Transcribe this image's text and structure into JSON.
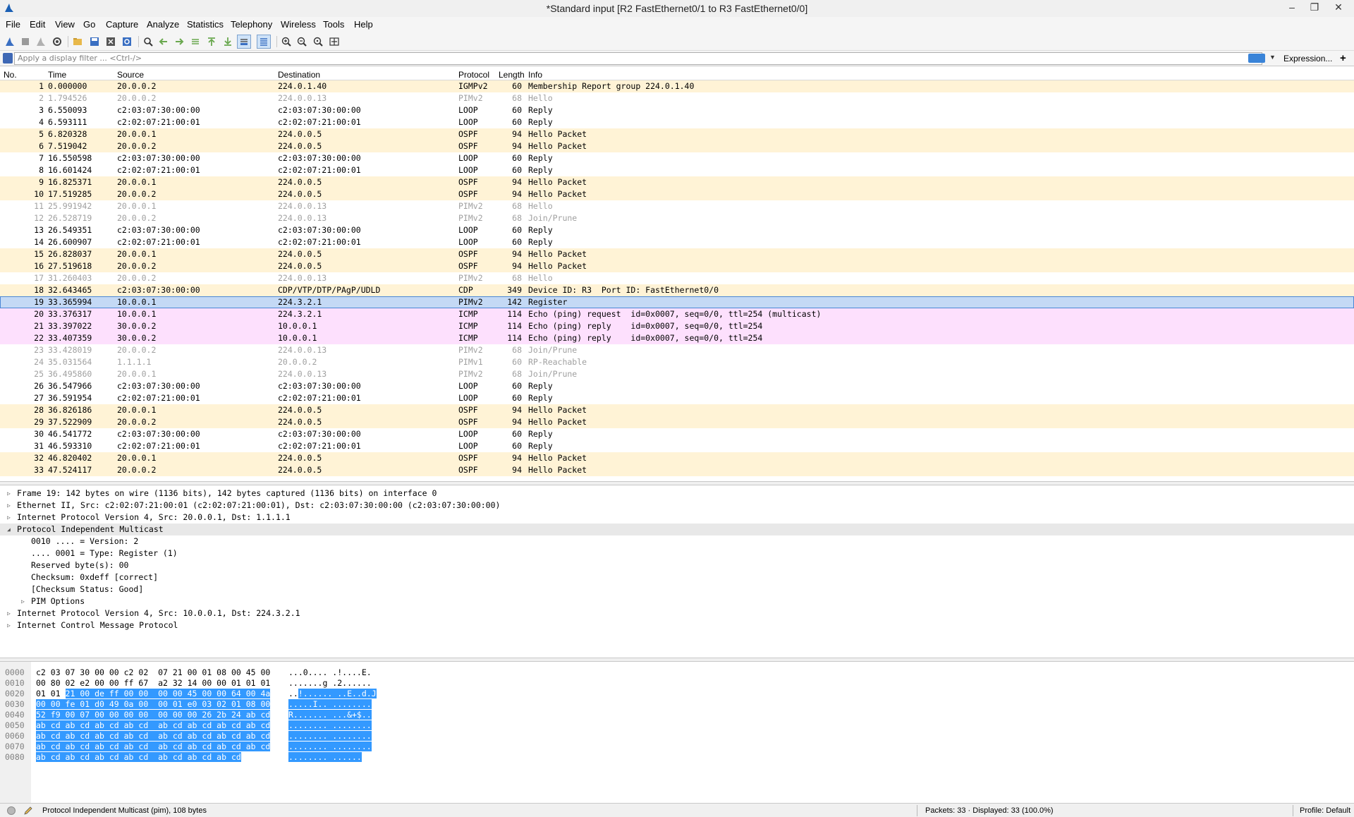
{
  "window": {
    "title": "*Standard input [R2 FastEthernet0/1 to R3 FastEthernet0/0]",
    "minimize": "–",
    "restore": "❐",
    "close": "✕"
  },
  "menu": [
    "File",
    "Edit",
    "View",
    "Go",
    "Capture",
    "Analyze",
    "Statistics",
    "Telephony",
    "Wireless",
    "Tools",
    "Help"
  ],
  "filter": {
    "placeholder": "Apply a display filter ... <Ctrl-/>",
    "expression_label": "Expression...",
    "add_label": "+",
    "dropdown_glyph": "▼"
  },
  "columns": [
    "No.",
    "Time",
    "Source",
    "Destination",
    "Protocol",
    "Length",
    "Info"
  ],
  "packets": [
    {
      "no": "1",
      "time": "0.000000",
      "src": "20.0.0.2",
      "dst": "224.0.1.40",
      "proto": "IGMPv2",
      "len": "60",
      "info": "Membership Report group 224.0.1.40",
      "cls": "igmp"
    },
    {
      "no": "2",
      "time": "1.794526",
      "src": "20.0.0.2",
      "dst": "224.0.0.13",
      "proto": "PIMv2",
      "len": "68",
      "info": "Hello",
      "cls": "pim"
    },
    {
      "no": "3",
      "time": "6.550093",
      "src": "c2:03:07:30:00:00",
      "dst": "c2:03:07:30:00:00",
      "proto": "LOOP",
      "len": "60",
      "info": "Reply",
      "cls": "loop"
    },
    {
      "no": "4",
      "time": "6.593111",
      "src": "c2:02:07:21:00:01",
      "dst": "c2:02:07:21:00:01",
      "proto": "LOOP",
      "len": "60",
      "info": "Reply",
      "cls": "loop"
    },
    {
      "no": "5",
      "time": "6.820328",
      "src": "20.0.0.1",
      "dst": "224.0.0.5",
      "proto": "OSPF",
      "len": "94",
      "info": "Hello Packet",
      "cls": "ospf"
    },
    {
      "no": "6",
      "time": "7.519042",
      "src": "20.0.0.2",
      "dst": "224.0.0.5",
      "proto": "OSPF",
      "len": "94",
      "info": "Hello Packet",
      "cls": "ospf"
    },
    {
      "no": "7",
      "time": "16.550598",
      "src": "c2:03:07:30:00:00",
      "dst": "c2:03:07:30:00:00",
      "proto": "LOOP",
      "len": "60",
      "info": "Reply",
      "cls": "loop"
    },
    {
      "no": "8",
      "time": "16.601424",
      "src": "c2:02:07:21:00:01",
      "dst": "c2:02:07:21:00:01",
      "proto": "LOOP",
      "len": "60",
      "info": "Reply",
      "cls": "loop"
    },
    {
      "no": "9",
      "time": "16.825371",
      "src": "20.0.0.1",
      "dst": "224.0.0.5",
      "proto": "OSPF",
      "len": "94",
      "info": "Hello Packet",
      "cls": "ospf"
    },
    {
      "no": "10",
      "time": "17.519285",
      "src": "20.0.0.2",
      "dst": "224.0.0.5",
      "proto": "OSPF",
      "len": "94",
      "info": "Hello Packet",
      "cls": "ospf"
    },
    {
      "no": "11",
      "time": "25.991942",
      "src": "20.0.0.1",
      "dst": "224.0.0.13",
      "proto": "PIMv2",
      "len": "68",
      "info": "Hello",
      "cls": "pim"
    },
    {
      "no": "12",
      "time": "26.528719",
      "src": "20.0.0.2",
      "dst": "224.0.0.13",
      "proto": "PIMv2",
      "len": "68",
      "info": "Join/Prune",
      "cls": "pim"
    },
    {
      "no": "13",
      "time": "26.549351",
      "src": "c2:03:07:30:00:00",
      "dst": "c2:03:07:30:00:00",
      "proto": "LOOP",
      "len": "60",
      "info": "Reply",
      "cls": "loop"
    },
    {
      "no": "14",
      "time": "26.600907",
      "src": "c2:02:07:21:00:01",
      "dst": "c2:02:07:21:00:01",
      "proto": "LOOP",
      "len": "60",
      "info": "Reply",
      "cls": "loop"
    },
    {
      "no": "15",
      "time": "26.828037",
      "src": "20.0.0.1",
      "dst": "224.0.0.5",
      "proto": "OSPF",
      "len": "94",
      "info": "Hello Packet",
      "cls": "ospf"
    },
    {
      "no": "16",
      "time": "27.519618",
      "src": "20.0.0.2",
      "dst": "224.0.0.5",
      "proto": "OSPF",
      "len": "94",
      "info": "Hello Packet",
      "cls": "ospf"
    },
    {
      "no": "17",
      "time": "31.260403",
      "src": "20.0.0.2",
      "dst": "224.0.0.13",
      "proto": "PIMv2",
      "len": "68",
      "info": "Hello",
      "cls": "pim"
    },
    {
      "no": "18",
      "time": "32.643465",
      "src": "c2:03:07:30:00:00",
      "dst": "CDP/VTP/DTP/PAgP/UDLD",
      "proto": "CDP",
      "len": "349",
      "info": "Device ID: R3  Port ID: FastEthernet0/0",
      "cls": "cdp"
    },
    {
      "no": "19",
      "time": "33.365994",
      "src": "10.0.0.1",
      "dst": "224.3.2.1",
      "proto": "PIMv2",
      "len": "142",
      "info": "Register",
      "cls": "selected"
    },
    {
      "no": "20",
      "time": "33.376317",
      "src": "10.0.0.1",
      "dst": "224.3.2.1",
      "proto": "ICMP",
      "len": "114",
      "info": "Echo (ping) request  id=0x0007, seq=0/0, ttl=254 (multicast)",
      "cls": "icmp"
    },
    {
      "no": "21",
      "time": "33.397022",
      "src": "30.0.0.2",
      "dst": "10.0.0.1",
      "proto": "ICMP",
      "len": "114",
      "info": "Echo (ping) reply    id=0x0007, seq=0/0, ttl=254",
      "cls": "icmp"
    },
    {
      "no": "22",
      "time": "33.407359",
      "src": "30.0.0.2",
      "dst": "10.0.0.1",
      "proto": "ICMP",
      "len": "114",
      "info": "Echo (ping) reply    id=0x0007, seq=0/0, ttl=254",
      "cls": "icmp"
    },
    {
      "no": "23",
      "time": "33.428019",
      "src": "20.0.0.2",
      "dst": "224.0.0.13",
      "proto": "PIMv2",
      "len": "68",
      "info": "Join/Prune",
      "cls": "pim"
    },
    {
      "no": "24",
      "time": "35.031564",
      "src": "1.1.1.1",
      "dst": "20.0.0.2",
      "proto": "PIMv1",
      "len": "60",
      "info": "RP-Reachable",
      "cls": "pim"
    },
    {
      "no": "25",
      "time": "36.495860",
      "src": "20.0.0.1",
      "dst": "224.0.0.13",
      "proto": "PIMv2",
      "len": "68",
      "info": "Join/Prune",
      "cls": "pim"
    },
    {
      "no": "26",
      "time": "36.547966",
      "src": "c2:03:07:30:00:00",
      "dst": "c2:03:07:30:00:00",
      "proto": "LOOP",
      "len": "60",
      "info": "Reply",
      "cls": "loop"
    },
    {
      "no": "27",
      "time": "36.591954",
      "src": "c2:02:07:21:00:01",
      "dst": "c2:02:07:21:00:01",
      "proto": "LOOP",
      "len": "60",
      "info": "Reply",
      "cls": "loop"
    },
    {
      "no": "28",
      "time": "36.826186",
      "src": "20.0.0.1",
      "dst": "224.0.0.5",
      "proto": "OSPF",
      "len": "94",
      "info": "Hello Packet",
      "cls": "ospf"
    },
    {
      "no": "29",
      "time": "37.522909",
      "src": "20.0.0.2",
      "dst": "224.0.0.5",
      "proto": "OSPF",
      "len": "94",
      "info": "Hello Packet",
      "cls": "ospf"
    },
    {
      "no": "30",
      "time": "46.541772",
      "src": "c2:03:07:30:00:00",
      "dst": "c2:03:07:30:00:00",
      "proto": "LOOP",
      "len": "60",
      "info": "Reply",
      "cls": "loop"
    },
    {
      "no": "31",
      "time": "46.593310",
      "src": "c2:02:07:21:00:01",
      "dst": "c2:02:07:21:00:01",
      "proto": "LOOP",
      "len": "60",
      "info": "Reply",
      "cls": "loop"
    },
    {
      "no": "32",
      "time": "46.820402",
      "src": "20.0.0.1",
      "dst": "224.0.0.5",
      "proto": "OSPF",
      "len": "94",
      "info": "Hello Packet",
      "cls": "ospf"
    },
    {
      "no": "33",
      "time": "47.524117",
      "src": "20.0.0.2",
      "dst": "224.0.0.5",
      "proto": "OSPF",
      "len": "94",
      "info": "Hello Packet",
      "cls": "ospf"
    }
  ],
  "details": [
    {
      "text": "Frame 19: 142 bytes on wire (1136 bits), 142 bytes captured (1136 bits) on interface 0",
      "level": 0,
      "toggle": "collapsed",
      "hl": false
    },
    {
      "text": "Ethernet II, Src: c2:02:07:21:00:01 (c2:02:07:21:00:01), Dst: c2:03:07:30:00:00 (c2:03:07:30:00:00)",
      "level": 0,
      "toggle": "collapsed",
      "hl": false
    },
    {
      "text": "Internet Protocol Version 4, Src: 20.0.0.1, Dst: 1.1.1.1",
      "level": 0,
      "toggle": "collapsed",
      "hl": false
    },
    {
      "text": "Protocol Independent Multicast",
      "level": 0,
      "toggle": "expanded",
      "hl": true
    },
    {
      "text": "0010 .... = Version: 2",
      "level": 1,
      "toggle": "none",
      "hl": false
    },
    {
      "text": ".... 0001 = Type: Register (1)",
      "level": 1,
      "toggle": "none",
      "hl": false
    },
    {
      "text": "Reserved byte(s): 00",
      "level": 1,
      "toggle": "none",
      "hl": false
    },
    {
      "text": "Checksum: 0xdeff [correct]",
      "level": 1,
      "toggle": "none",
      "hl": false
    },
    {
      "text": "[Checksum Status: Good]",
      "level": 1,
      "toggle": "none",
      "hl": false
    },
    {
      "text": "PIM Options",
      "level": 1,
      "toggle": "collapsed",
      "hl": false
    },
    {
      "text": "Internet Protocol Version 4, Src: 10.0.0.1, Dst: 224.3.2.1",
      "level": 0,
      "toggle": "collapsed",
      "hl": false
    },
    {
      "text": "Internet Control Message Protocol",
      "level": 0,
      "toggle": "collapsed",
      "hl": false
    }
  ],
  "bytes": [
    {
      "off": "0000",
      "hex_pre": "c2 03 07 30 00 00 c2 02  07 21 00 01 08 00 45 00",
      "hex_sel": "",
      "asc_pre": "...0.... .!....E.",
      "asc_sel": ""
    },
    {
      "off": "0010",
      "hex_pre": "00 80 02 e2 00 00 ff 67  a2 32 14 00 00 01 01 01",
      "hex_sel": "",
      "asc_pre": ".......g .2......",
      "asc_sel": ""
    },
    {
      "off": "0020",
      "hex_pre": "01 01 ",
      "hex_sel": "21 00 de ff 00 00  00 00 45 00 00 64 00 4a",
      "asc_pre": "..",
      "asc_sel": "!...... ..E..d.J"
    },
    {
      "off": "0030",
      "hex_pre": "",
      "hex_sel": "00 00 fe 01 d0 49 0a 00  00 01 e0 03 02 01 08 00",
      "asc_pre": "",
      "asc_sel": ".....I.. ........"
    },
    {
      "off": "0040",
      "hex_pre": "",
      "hex_sel": "52 f9 00 07 00 00 00 00  00 00 00 26 2b 24 ab cd",
      "asc_pre": "",
      "asc_sel": "R....... ...&+$.."
    },
    {
      "off": "0050",
      "hex_pre": "",
      "hex_sel": "ab cd ab cd ab cd ab cd  ab cd ab cd ab cd ab cd",
      "asc_pre": "",
      "asc_sel": "........ ........"
    },
    {
      "off": "0060",
      "hex_pre": "",
      "hex_sel": "ab cd ab cd ab cd ab cd  ab cd ab cd ab cd ab cd",
      "asc_pre": "",
      "asc_sel": "........ ........"
    },
    {
      "off": "0070",
      "hex_pre": "",
      "hex_sel": "ab cd ab cd ab cd ab cd  ab cd ab cd ab cd ab cd",
      "asc_pre": "",
      "asc_sel": "........ ........"
    },
    {
      "off": "0080",
      "hex_pre": "",
      "hex_sel": "ab cd ab cd ab cd ab cd  ab cd ab cd ab cd",
      "asc_pre": "",
      "asc_sel": "........ ......"
    }
  ],
  "status": {
    "message": "Protocol Independent Multicast (pim), 108 bytes",
    "packets": "Packets: 33 · Displayed: 33 (100.0%)",
    "profile": "Profile: Default"
  },
  "colors": {
    "selection": "#3399ff",
    "selected_row": "#c4d9f5",
    "ospf_row": "#fff3d6",
    "icmp_row": "#fde0fd",
    "pim_text": "#a0a0a0"
  }
}
